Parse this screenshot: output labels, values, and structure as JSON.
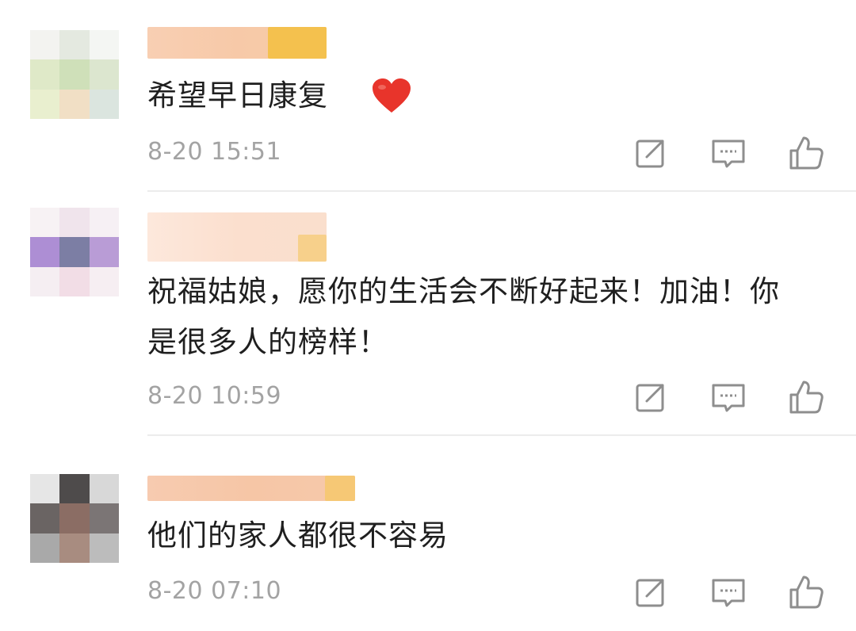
{
  "comments": [
    {
      "text": "希望早日康复",
      "has_heart": true,
      "time": "8-20 15:51"
    },
    {
      "text": "祝福姑娘，愿你的生活会不断好起来！加油！你是很多人的榜样！",
      "has_heart": false,
      "time": "8-20 10:59"
    },
    {
      "text": "他们的家人都很不容易",
      "has_heart": false,
      "time": "8-20 07:10"
    }
  ],
  "colors": {
    "text": "#1f1f1f",
    "time": "#a3a3a3",
    "icon": "#8e8e8e",
    "heart": "#e8342b",
    "divider": "#ececec",
    "name_blur": "#f6c9a6",
    "name_blur_accent": "#f4c256"
  },
  "icons": {
    "share": "share-icon",
    "comment": "comment-icon",
    "like": "thumbs-up-icon",
    "heart": "heart-icon"
  }
}
